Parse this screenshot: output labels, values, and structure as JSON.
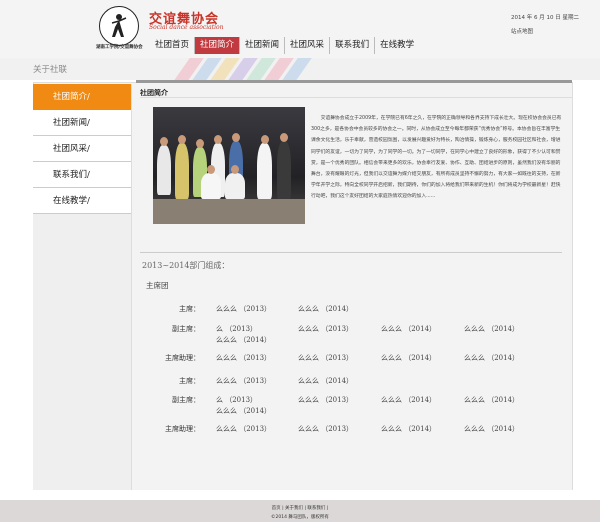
{
  "header": {
    "brand_title": "交谊舞协会",
    "brand_subtitle": "Social dance association",
    "school_line": "湖南工学院/交谊舞协会",
    "date": "2014 年 6 月 10 日  星期二",
    "sitemap": "站点地图"
  },
  "nav": {
    "items": [
      "社团首页",
      "社团简介",
      "社团新闻",
      "社团风采",
      "联系我们",
      "在线教学"
    ],
    "active_index": 1
  },
  "banner": {
    "title": "关于社联"
  },
  "sidebar": {
    "items": [
      "社团简介/",
      "社团新闻/",
      "社团风采/",
      "联系我们/",
      "在线教学/"
    ],
    "active_index": 0
  },
  "main": {
    "section_title": "社团简介",
    "intro": "交谊舞协会成立于2009年，在学院已有6年之久，在学院的正确领导和各界支持下成长壮大。现在校协会会员已有300之多，是各协会中会员较多的协会之一。同时，从协会成立至今每年都荣获“优秀协会”称号。本协会旨在丰富学生课余文化生活，乐于奉献，营造校园氛围，以发展兴趣爱好为特长，陶冶情操，锻炼身心，服务校园社区和社会，增进同学们的友谊，一切为了同学，为了同学的一切。为了一切同学，在同学心中建立了良好的形象，获得了不少认可和赞赏，是一个优秀的团队。相信会带来更多的欢乐，协会奉行友爱、协作、互助、团结进步的原则，虽然我们没有华丽的舞台，没有耀眼的灯光，但我们以交谊舞为媒介结交朋友，有所有成员坚持不懈的努力，有大家一如既往的支持，在新学年开学之际，特向全校同学开启招新，我们期待，你们的加入将给我们带来新的生机！你们将成为学校最新星！赶快行动吧，我们这个友好团结的大家庭热情欢迎你的加入......",
    "dept_title": "2013~2014部门组成：",
    "presidium_title": "主席团",
    "rows": [
      {
        "role": "主席：",
        "names": [
          "么么么 （2013）",
          "么么么 （2014）"
        ]
      },
      {
        "role": "副主席：",
        "names": [
          "么 （2013）",
          "么么么 （2013）",
          "么么么 （2014）",
          "么么么 （2014）",
          "么么么 （2014）"
        ]
      },
      {
        "role": "主席助理：",
        "names": [
          "么么么 （2013）",
          "么么么 （2013）",
          "么么么 （2014）",
          "么么么 （2014）"
        ]
      },
      {
        "role": "主席：",
        "names": [
          "么么么 （2013）",
          "么么么 （2014）"
        ]
      },
      {
        "role": "副主席：",
        "names": [
          "么 （2013）",
          "么么么 （2013）",
          "么么么 （2014）",
          "么么么 （2014）",
          "么么么 （2014）"
        ]
      },
      {
        "role": "主席助理：",
        "names": [
          "么么么 （2013）",
          "么么么 （2013）",
          "么么么 （2014）",
          "么么么 （2014）"
        ]
      }
    ]
  },
  "footer": {
    "links": "首页 | 关于我们 | 联系我们 |",
    "copyright": "©2014  舞马团队，版权所有"
  },
  "colors": {
    "nav_active": "#c03a3f",
    "sidebar_active": "#f08a12",
    "brand": "#c8342a"
  }
}
